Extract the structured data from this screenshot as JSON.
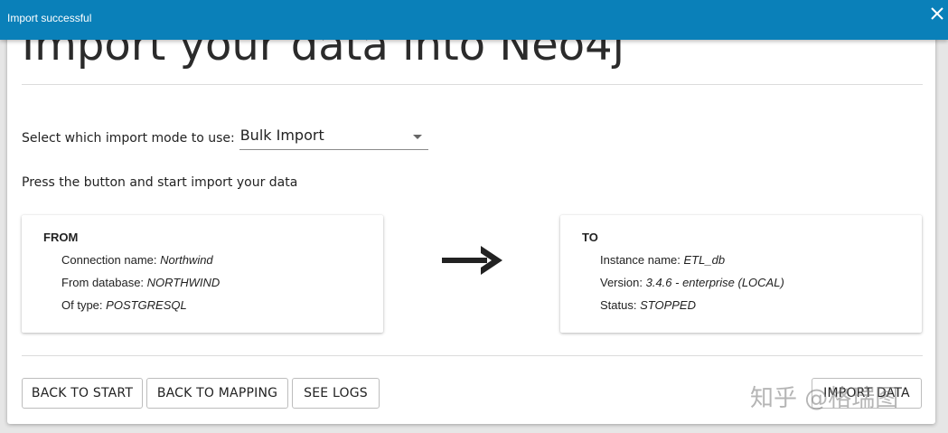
{
  "toast": {
    "message": "Import successful",
    "close_icon": "close-icon",
    "color": "#0a80b9"
  },
  "page": {
    "title": "Import your data into Neo4j"
  },
  "mode": {
    "label": "Select which import mode to use:",
    "selected": "Bulk Import"
  },
  "instruction": "Press the button and start import your data",
  "from": {
    "heading": "FROM",
    "rows": [
      {
        "label": "Connection name:",
        "value": "Northwind"
      },
      {
        "label": "From database:",
        "value": "NORTHWIND"
      },
      {
        "label": "Of type:",
        "value": "POSTGRESQL"
      }
    ]
  },
  "to": {
    "heading": "TO",
    "rows": [
      {
        "label": "Instance name:",
        "value": "ETL_db"
      },
      {
        "label": "Version:",
        "value": "3.4.6 - enterprise (LOCAL)"
      },
      {
        "label": "Status:",
        "value": "STOPPED"
      }
    ]
  },
  "arrow_icon": "arrow-right-icon",
  "buttons": {
    "back_to_start": "BACK TO START",
    "back_to_mapping": "BACK TO MAPPING",
    "see_logs": "SEE LOGS",
    "import_data": "IMPORT DATA"
  },
  "watermark": "知乎 @格瑞图"
}
